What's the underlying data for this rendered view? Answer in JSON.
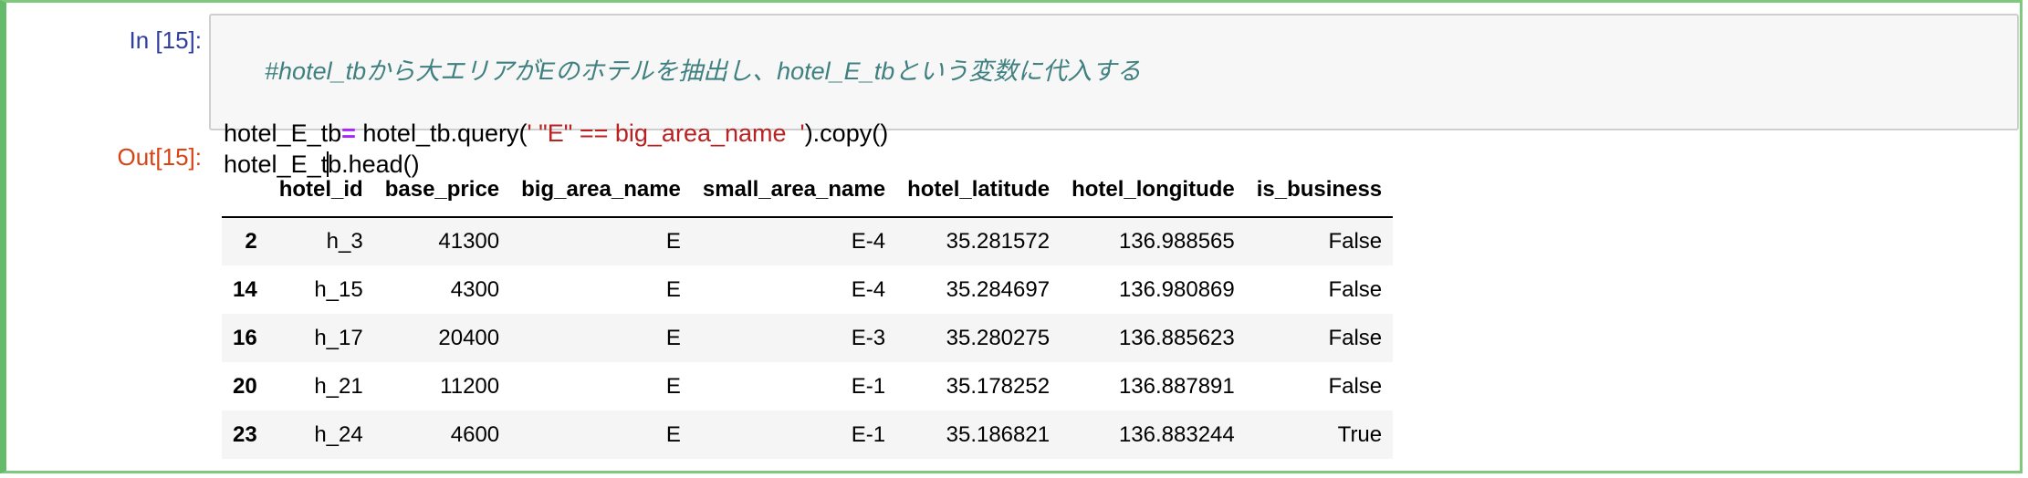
{
  "cell": {
    "in_prompt": "In [15]:",
    "out_prompt": "Out[15]:",
    "code": {
      "line1": "#hotel_tbから大エリアがEのホテルを抽出し、hotel_E_tbという変数に代入する",
      "line2_a": "hotel_E_tb",
      "line2_op": "=",
      "line2_b": " hotel_tb.query(",
      "line2_str": "' \"E\" == big_area_name  '",
      "line2_c": ").copy()",
      "line3_a": "hotel_E_t",
      "line3_b": "b.head()"
    }
  },
  "table": {
    "index_header": "",
    "columns": [
      "hotel_id",
      "base_price",
      "big_area_name",
      "small_area_name",
      "hotel_latitude",
      "hotel_longitude",
      "is_business"
    ],
    "rows": [
      {
        "index": "2",
        "cells": [
          "h_3",
          "41300",
          "E",
          "E-4",
          "35.281572",
          "136.988565",
          "False"
        ]
      },
      {
        "index": "14",
        "cells": [
          "h_15",
          "4300",
          "E",
          "E-4",
          "35.284697",
          "136.980869",
          "False"
        ]
      },
      {
        "index": "16",
        "cells": [
          "h_17",
          "20400",
          "E",
          "E-3",
          "35.280275",
          "136.885623",
          "False"
        ]
      },
      {
        "index": "20",
        "cells": [
          "h_21",
          "11200",
          "E",
          "E-1",
          "35.178252",
          "136.887891",
          "False"
        ]
      },
      {
        "index": "23",
        "cells": [
          "h_24",
          "4600",
          "E",
          "E-1",
          "35.186821",
          "136.883244",
          "True"
        ]
      }
    ]
  }
}
